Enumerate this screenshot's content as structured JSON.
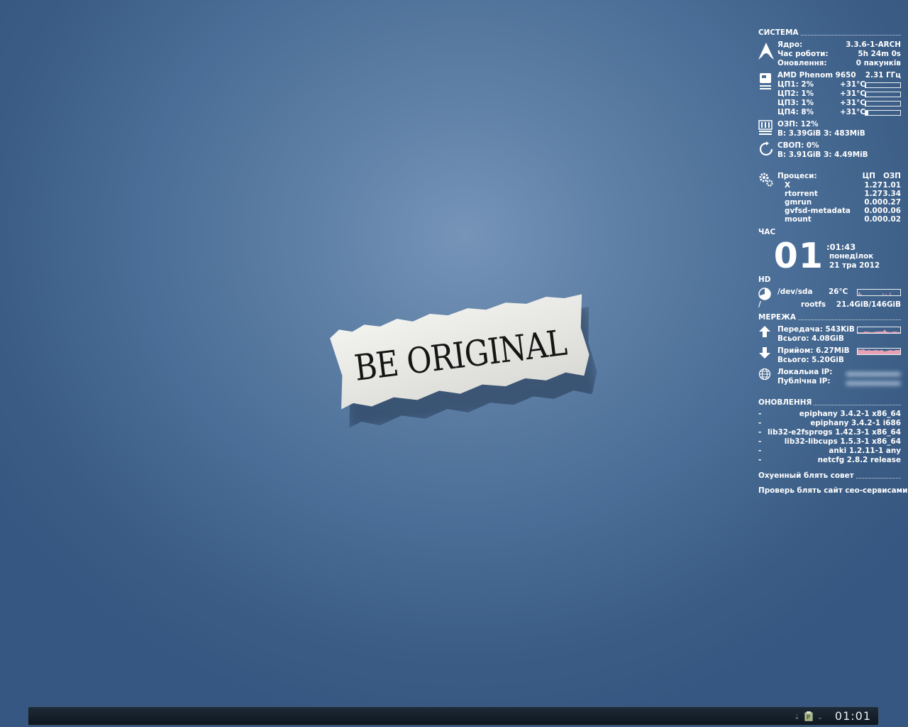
{
  "wallpaper": {
    "text": "BE ORIGINAL"
  },
  "system": {
    "header": "СИСТЕМА",
    "arch": [
      {
        "label": "Ядро:",
        "value": "3.3.6-1-ARCH"
      },
      {
        "label": "Час роботи:",
        "value": "5h 24m 0s"
      },
      {
        "label": "Оновлення:",
        "value": "0 пакунків"
      }
    ],
    "cpu_name": "AMD Phenom 9650",
    "cpu_freq": "2.31 ГГц",
    "cores": [
      {
        "label": "ЦП1: 2%",
        "temp": "+31°C",
        "usage": 2
      },
      {
        "label": "ЦП2: 1%",
        "temp": "+31°C",
        "usage": 1
      },
      {
        "label": "ЦП3: 1%",
        "temp": "+31°C",
        "usage": 1
      },
      {
        "label": "ЦП4: 8%",
        "temp": "+31°C",
        "usage": 8
      }
    ],
    "ram_title": "ОЗП: 12%",
    "ram_detail": "В: 3.39GiB З: 483MiB",
    "swap_title": "СВОП: 0%",
    "swap_detail": "В: 3.91GiB З: 4.49MiB",
    "proc_title": "Процеси:",
    "proc_col_cpu": "ЦП",
    "proc_col_ram": "ОЗП",
    "processes": [
      {
        "name": "X",
        "cpu": "1.27",
        "ram": "1.01"
      },
      {
        "name": "rtorrent",
        "cpu": "1.27",
        "ram": "3.34"
      },
      {
        "name": "gmrun",
        "cpu": "0.00",
        "ram": "0.27"
      },
      {
        "name": "gvfsd-metadata",
        "cpu": "0.00",
        "ram": "0.06"
      },
      {
        "name": "mount",
        "cpu": "0.00",
        "ram": "0.02"
      }
    ]
  },
  "time": {
    "header": "ЧАС",
    "hour": "01",
    "minsec": ":01:43",
    "weekday": "понеділок",
    "date": "21 тра 2012"
  },
  "hd": {
    "header": "HD",
    "device": "/dev/sda",
    "temp": "26°C",
    "mount": "/",
    "fs": "rootfs",
    "usage": "21.4GiB/146GiB"
  },
  "net": {
    "header": "МЕРЕЖА",
    "up_label": "Передача: 543KiB",
    "up_total": "Всього: 4.08GiB",
    "down_label": "Прийом: 6.27MiB",
    "down_total": "Всього: 5.20GiB",
    "local_ip_label": "Локальна IP:",
    "public_ip_label": "Публічна IP:"
  },
  "updates": {
    "header": "ОНОВЛЕННЯ",
    "items": [
      {
        "dash": "-",
        "pkg": "epiphany 3.4.2-1 x86_64"
      },
      {
        "dash": "-",
        "pkg": "epiphany 3.4.2-1 i686"
      },
      {
        "dash": "-",
        "pkg": "lib32-e2fsprogs 1.42.3-1 x86_64"
      },
      {
        "dash": "-",
        "pkg": "lib32-libcups 1.5.3-1 x86_64"
      },
      {
        "dash": "-",
        "pkg": "anki 1.2.11-1 any"
      },
      {
        "dash": "-",
        "pkg": "netcfg 2.8.2 release"
      }
    ]
  },
  "advice": {
    "header": "Охуенный блять совет",
    "text": "Проверь блять сайт сео-сервисами!"
  },
  "panel": {
    "clock": "01:01"
  },
  "colors": {
    "net_graph": "#e8a0b4",
    "text": "#ffffff",
    "panel_bg": "#131c26"
  }
}
